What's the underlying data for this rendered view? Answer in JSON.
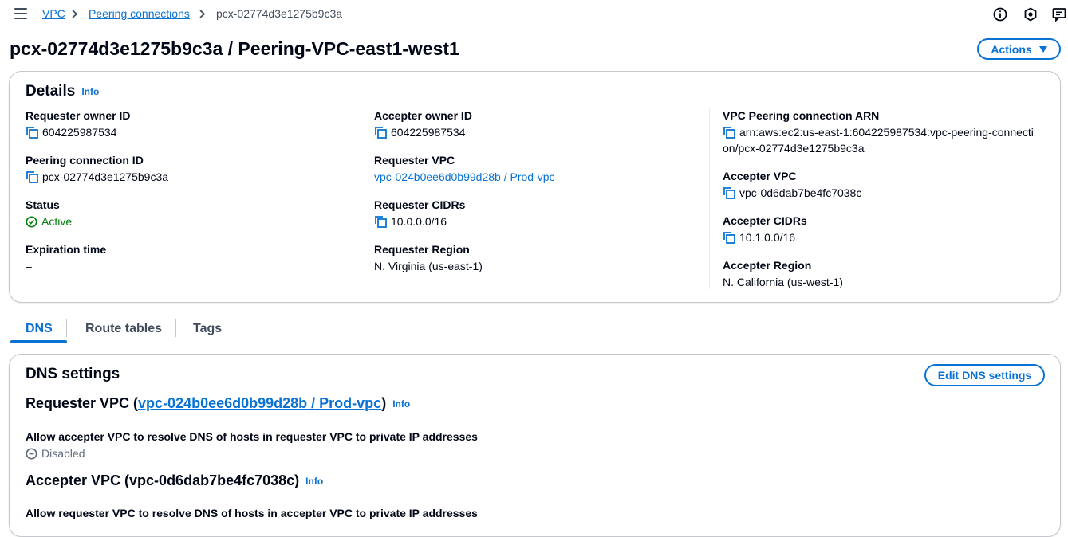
{
  "breadcrumb": {
    "items": [
      "VPC",
      "Peering connections"
    ],
    "current": "pcx-02774d3e1275b9c3a"
  },
  "icons": {
    "menu": "hamburger-menu-icon",
    "info": "info-circle-icon",
    "notifications": "shield-notification-icon",
    "feedback": "feedback-icon"
  },
  "header": {
    "title": "pcx-02774d3e1275b9c3a / Peering-VPC-east1-west1",
    "actions_label": "Actions"
  },
  "details": {
    "title": "Details",
    "info": "Info",
    "col1": {
      "requester_owner_id_label": "Requester owner ID",
      "requester_owner_id": "604225987534",
      "peering_connection_id_label": "Peering connection ID",
      "peering_connection_id": "pcx-02774d3e1275b9c3a",
      "status_label": "Status",
      "status": "Active",
      "expiration_label": "Expiration time",
      "expiration": "–"
    },
    "col2": {
      "accepter_owner_id_label": "Accepter owner ID",
      "accepter_owner_id": "604225987534",
      "requester_vpc_label": "Requester VPC",
      "requester_vpc": "vpc-024b0ee6d0b99d28b / Prod-vpc",
      "requester_cidrs_label": "Requester CIDRs",
      "requester_cidrs": "10.0.0.0/16",
      "requester_region_label": "Requester Region",
      "requester_region": "N. Virginia (us-east-1)"
    },
    "col3": {
      "arn_label": "VPC Peering connection ARN",
      "arn_line1": "arn:aws:ec2:us-east-1:604225987534:vpc-peering-connecti",
      "arn_line2": "on/pcx-02774d3e1275b9c3a",
      "accepter_vpc_label": "Accepter VPC",
      "accepter_vpc": "vpc-0d6dab7be4fc7038c",
      "accepter_cidrs_label": "Accepter CIDRs",
      "accepter_cidrs": "10.1.0.0/16",
      "accepter_region_label": "Accepter Region",
      "accepter_region": "N. California (us-west-1)"
    }
  },
  "tabs": [
    "DNS",
    "Route tables",
    "Tags"
  ],
  "dns": {
    "title": "DNS settings",
    "edit_label": "Edit DNS settings",
    "requester_prefix": "Requester VPC (",
    "requester_link": "vpc-024b0ee6d0b99d28b / Prod-vpc",
    "requester_suffix": ")",
    "info": "Info",
    "allow_accepter_label": "Allow accepter VPC to resolve DNS of hosts in requester VPC to private IP addresses",
    "allow_accepter_value": "Disabled",
    "accepter_heading": "Accepter VPC (vpc-0d6dab7be4fc7038c)",
    "allow_requester_label": "Allow requester VPC to resolve DNS of hosts in accepter VPC to private IP addresses"
  },
  "colors": {
    "link": "#0972d3",
    "success": "#037f0c",
    "text": "#000716",
    "border": "#c6c6cd"
  }
}
